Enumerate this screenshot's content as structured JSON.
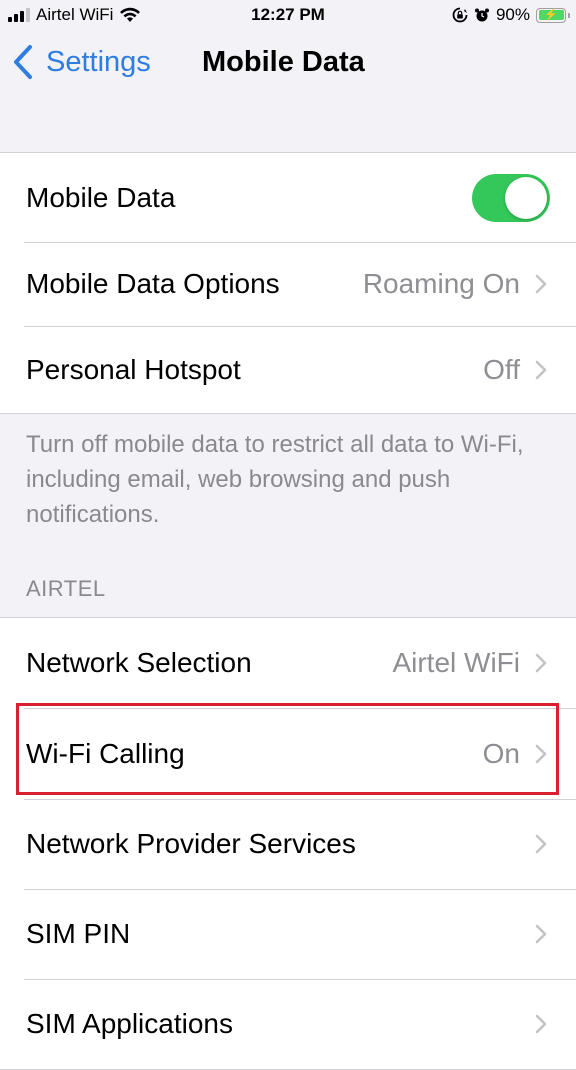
{
  "status_bar": {
    "carrier": "Airtel WiFi",
    "time": "12:27 PM",
    "battery_percent": "90%",
    "signal_bars_active": 3,
    "signal_bars_total": 4,
    "icons": [
      "cellular-signal-icon",
      "wifi-icon",
      "orientation-lock-icon",
      "alarm-icon",
      "battery-charging-icon"
    ],
    "battery_charging_glyph": "⚡"
  },
  "nav": {
    "back_label": "Settings",
    "title": "Mobile Data"
  },
  "group1": {
    "rows": [
      {
        "label": "Mobile Data",
        "control": "toggle",
        "toggle_on": true
      },
      {
        "label": "Mobile Data Options",
        "value": "Roaming On"
      },
      {
        "label": "Personal Hotspot",
        "value": "Off"
      }
    ],
    "footer": "Turn off mobile data to restrict all data to Wi-Fi, including email, web browsing and push notifications."
  },
  "group2": {
    "header": "AIRTEL",
    "rows": [
      {
        "label": "Network Selection",
        "value": "Airtel WiFi"
      },
      {
        "label": "Wi-Fi Calling",
        "value": "On",
        "highlighted": true
      },
      {
        "label": "Network Provider Services",
        "value": ""
      },
      {
        "label": "SIM PIN",
        "value": ""
      },
      {
        "label": "SIM Applications",
        "value": ""
      }
    ]
  },
  "colors": {
    "accent": "#2f7de1",
    "toggle_on": "#34c759",
    "highlight_border": "#d9202f",
    "background": "#f2f2f7",
    "secondary_text": "#8e8e93"
  }
}
